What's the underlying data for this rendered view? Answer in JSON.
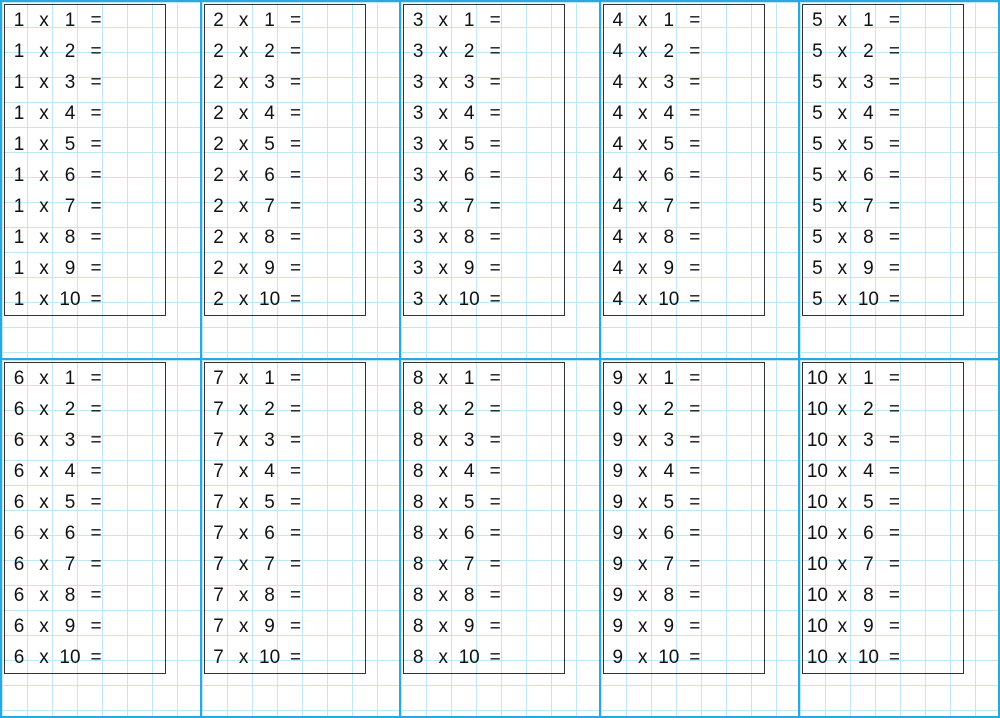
{
  "symbols": {
    "times": "x",
    "equals": "="
  },
  "blocks": [
    {
      "multiplicand": 1,
      "rows": [
        1,
        2,
        3,
        4,
        5,
        6,
        7,
        8,
        9,
        10
      ]
    },
    {
      "multiplicand": 2,
      "rows": [
        1,
        2,
        3,
        4,
        5,
        6,
        7,
        8,
        9,
        10
      ]
    },
    {
      "multiplicand": 3,
      "rows": [
        1,
        2,
        3,
        4,
        5,
        6,
        7,
        8,
        9,
        10
      ]
    },
    {
      "multiplicand": 4,
      "rows": [
        1,
        2,
        3,
        4,
        5,
        6,
        7,
        8,
        9,
        10
      ]
    },
    {
      "multiplicand": 5,
      "rows": [
        1,
        2,
        3,
        4,
        5,
        6,
        7,
        8,
        9,
        10
      ]
    },
    {
      "multiplicand": 6,
      "rows": [
        1,
        2,
        3,
        4,
        5,
        6,
        7,
        8,
        9,
        10
      ]
    },
    {
      "multiplicand": 7,
      "rows": [
        1,
        2,
        3,
        4,
        5,
        6,
        7,
        8,
        9,
        10
      ]
    },
    {
      "multiplicand": 8,
      "rows": [
        1,
        2,
        3,
        4,
        5,
        6,
        7,
        8,
        9,
        10
      ]
    },
    {
      "multiplicand": 9,
      "rows": [
        1,
        2,
        3,
        4,
        5,
        6,
        7,
        8,
        9,
        10
      ]
    },
    {
      "multiplicand": 10,
      "rows": [
        1,
        2,
        3,
        4,
        5,
        6,
        7,
        8,
        9,
        10
      ]
    }
  ]
}
